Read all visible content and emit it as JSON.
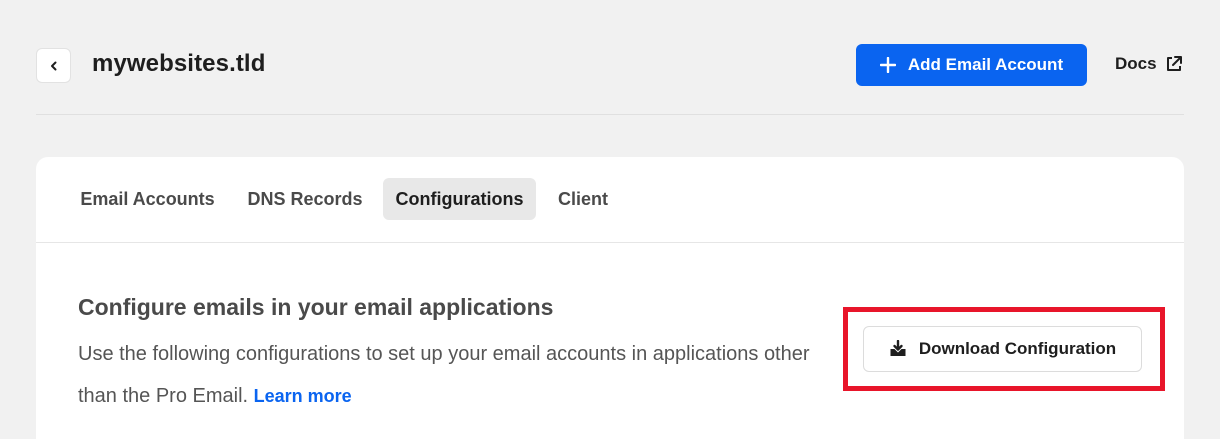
{
  "header": {
    "back_icon": "chevron-left-icon",
    "title": "mywebsites.tld",
    "add_button_label": "Add Email Account",
    "add_button_icon": "plus-icon",
    "docs_label": "Docs",
    "docs_icon": "external-link-icon"
  },
  "tabs": [
    {
      "label": "Email Accounts",
      "active": false
    },
    {
      "label": "DNS Records",
      "active": false
    },
    {
      "label": "Configurations",
      "active": true
    },
    {
      "label": "Client",
      "active": false
    }
  ],
  "config": {
    "title": "Configure emails in your email applications",
    "description": "Use the following configurations to set up your email accounts in applications other than the Pro Email.",
    "learn_more": "Learn more",
    "download_label": "Download Configuration",
    "download_icon": "download-tray-icon"
  },
  "colors": {
    "primary": "#0a64f0",
    "background": "#f1f1f1",
    "highlight": "#e8152a",
    "active_tab_bg": "#e8e8e8"
  }
}
